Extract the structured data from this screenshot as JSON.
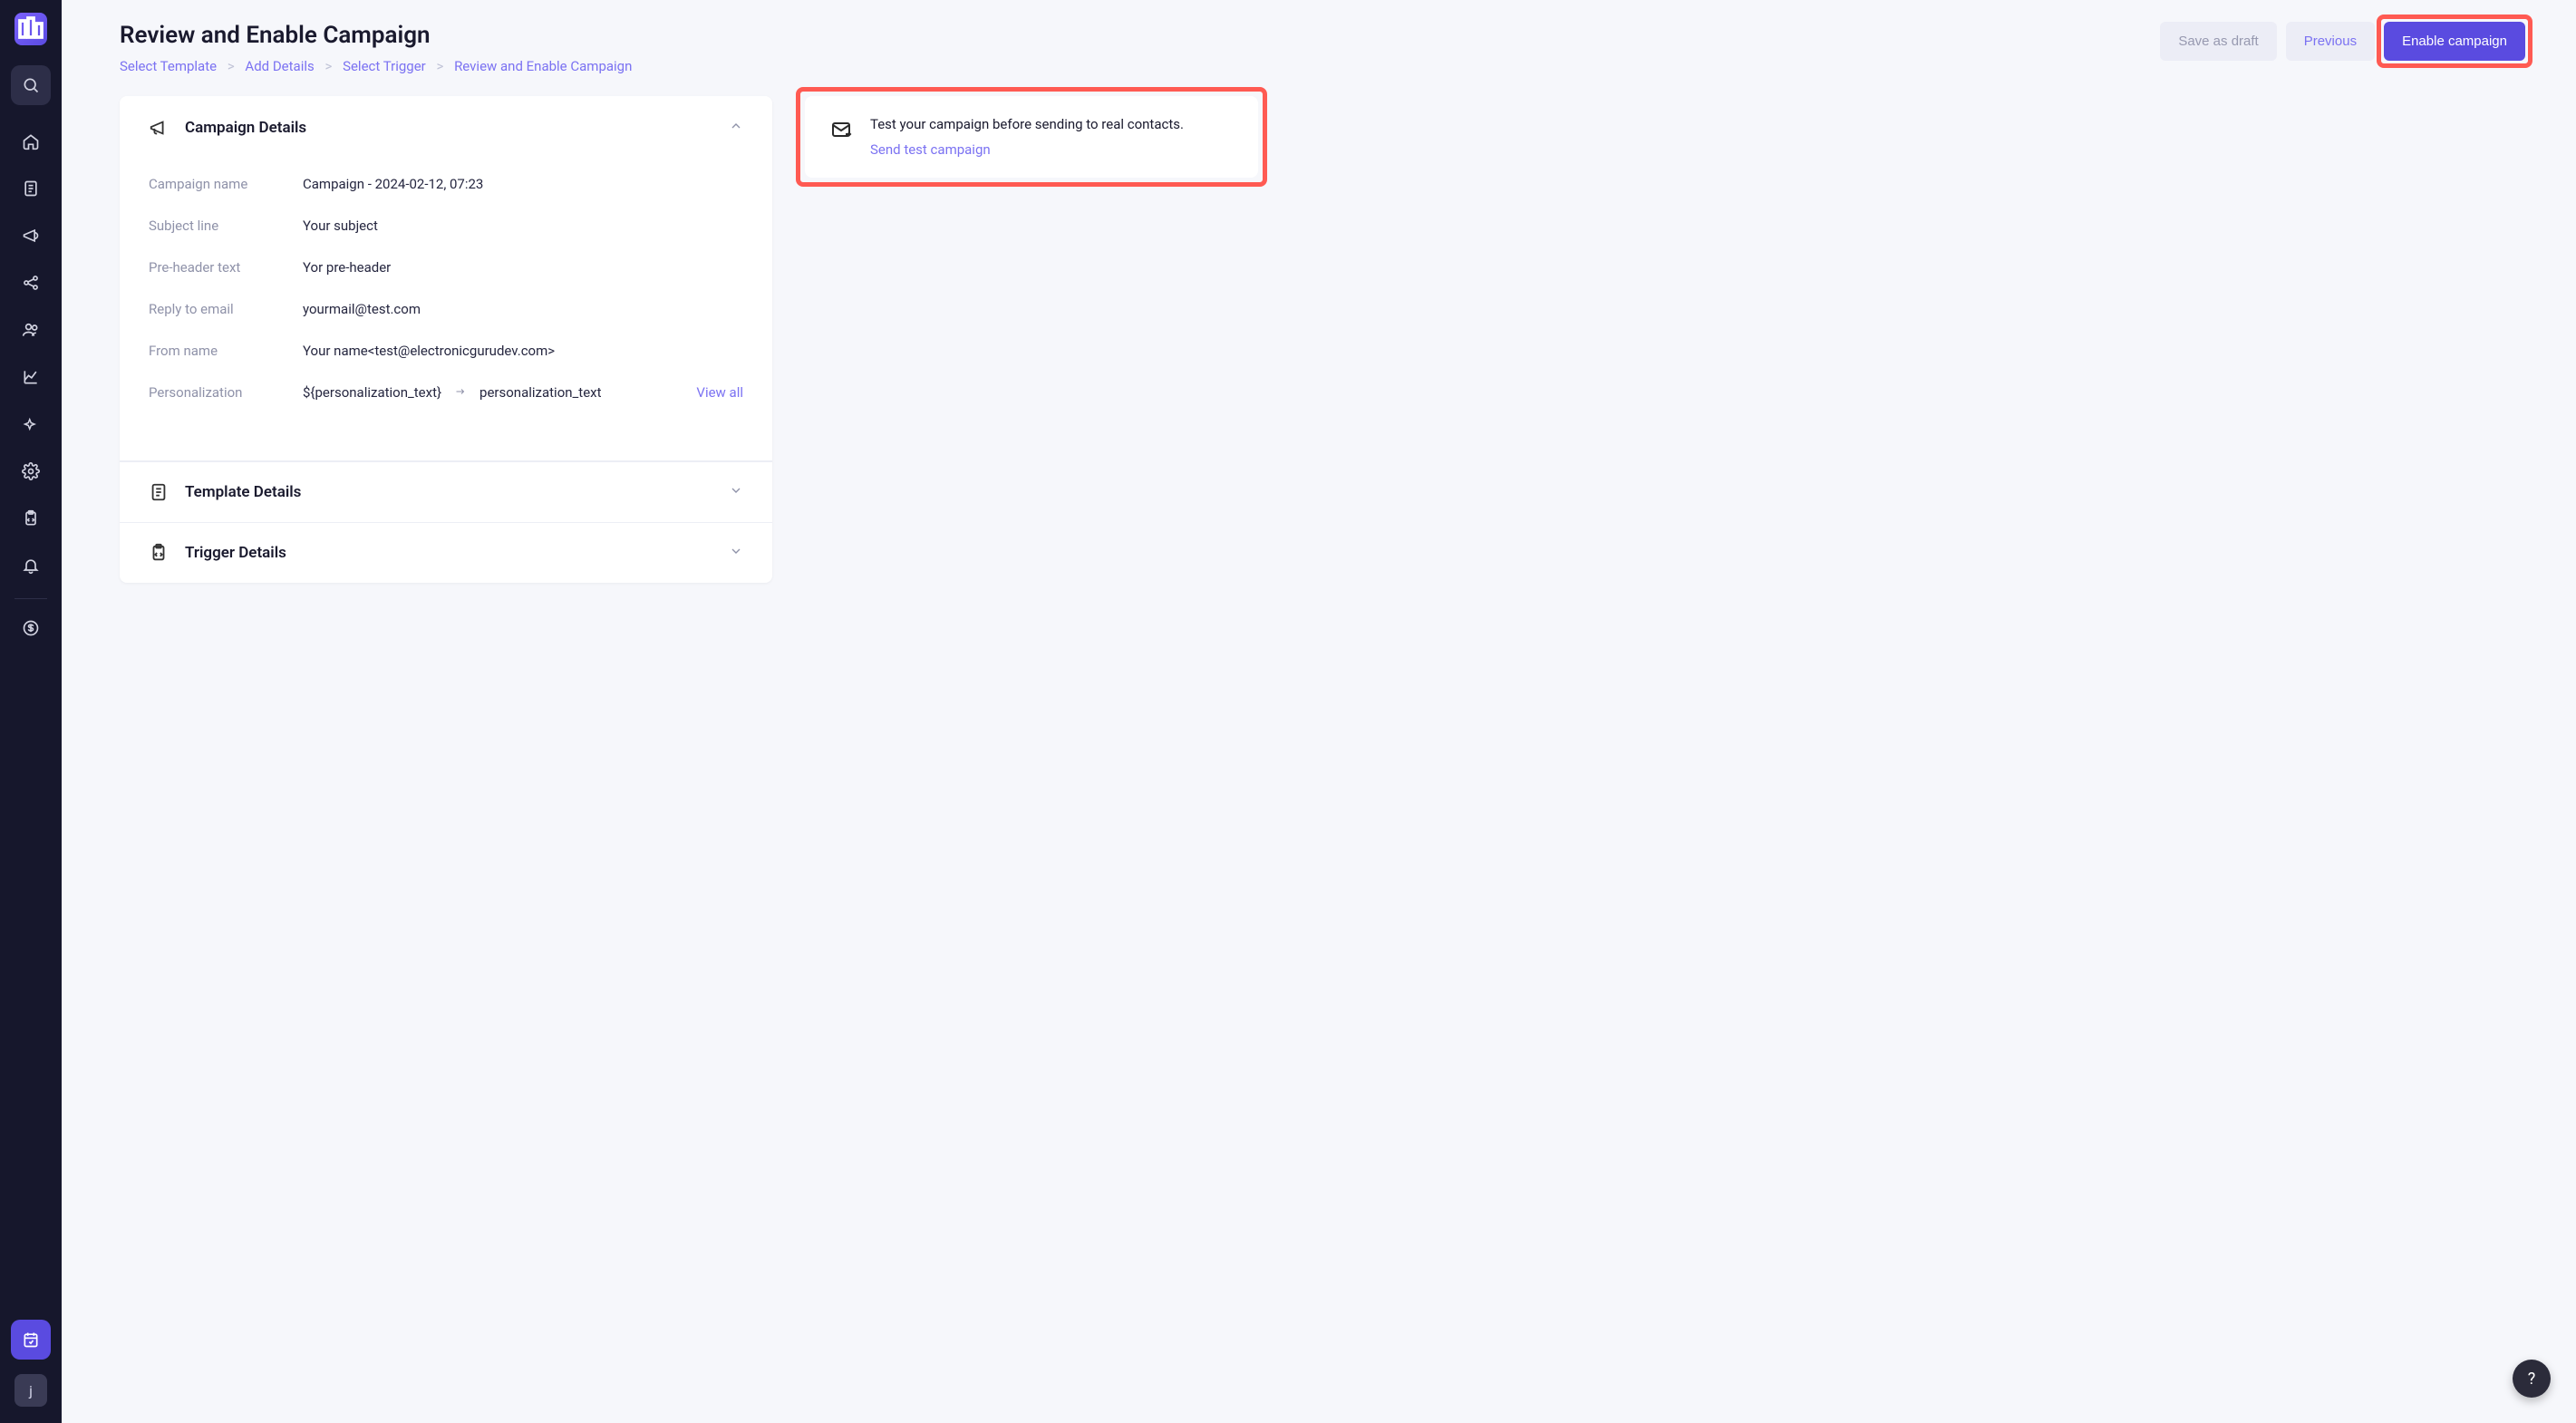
{
  "sidebar": {
    "icons": [
      "search",
      "home",
      "document",
      "megaphone",
      "share",
      "users",
      "chart",
      "spark",
      "gear",
      "clipboard-code",
      "bell"
    ],
    "divider_after": "bell",
    "money_icon": "dollar",
    "bottom_primary_icon": "calendar",
    "avatar_initial": "j"
  },
  "header": {
    "title": "Review and Enable Campaign",
    "breadcrumbs": [
      {
        "label": "Select Template",
        "link": true
      },
      {
        "label": "Add Details",
        "link": true
      },
      {
        "label": "Select Trigger",
        "link": true
      },
      {
        "label": "Review and Enable Campaign",
        "link": true
      }
    ],
    "actions": {
      "save_draft": "Save as draft",
      "previous": "Previous",
      "enable": "Enable campaign"
    }
  },
  "campaign_details": {
    "section_title": "Campaign Details",
    "rows": {
      "campaign_name_label": "Campaign name",
      "campaign_name_value": "Campaign - 2024-02-12, 07:23",
      "subject_label": "Subject line",
      "subject_value": "Your subject",
      "preheader_label": "Pre-header text",
      "preheader_value": "Yor pre-header",
      "replyto_label": "Reply to email",
      "replyto_value": "yourmail@test.com",
      "from_label": "From name",
      "from_value": "Your name<test@electronicgurudev.com>",
      "personalization_label": "Personalization",
      "personalization_token": "${personalization_text}",
      "personalization_resolved": "personalization_text",
      "view_all": "View all"
    }
  },
  "template_section": {
    "title": "Template Details"
  },
  "trigger_section": {
    "title": "Trigger Details"
  },
  "test_panel": {
    "message": "Test your campaign before sending to real contacts.",
    "link": "Send test campaign"
  },
  "help_fab": "?"
}
